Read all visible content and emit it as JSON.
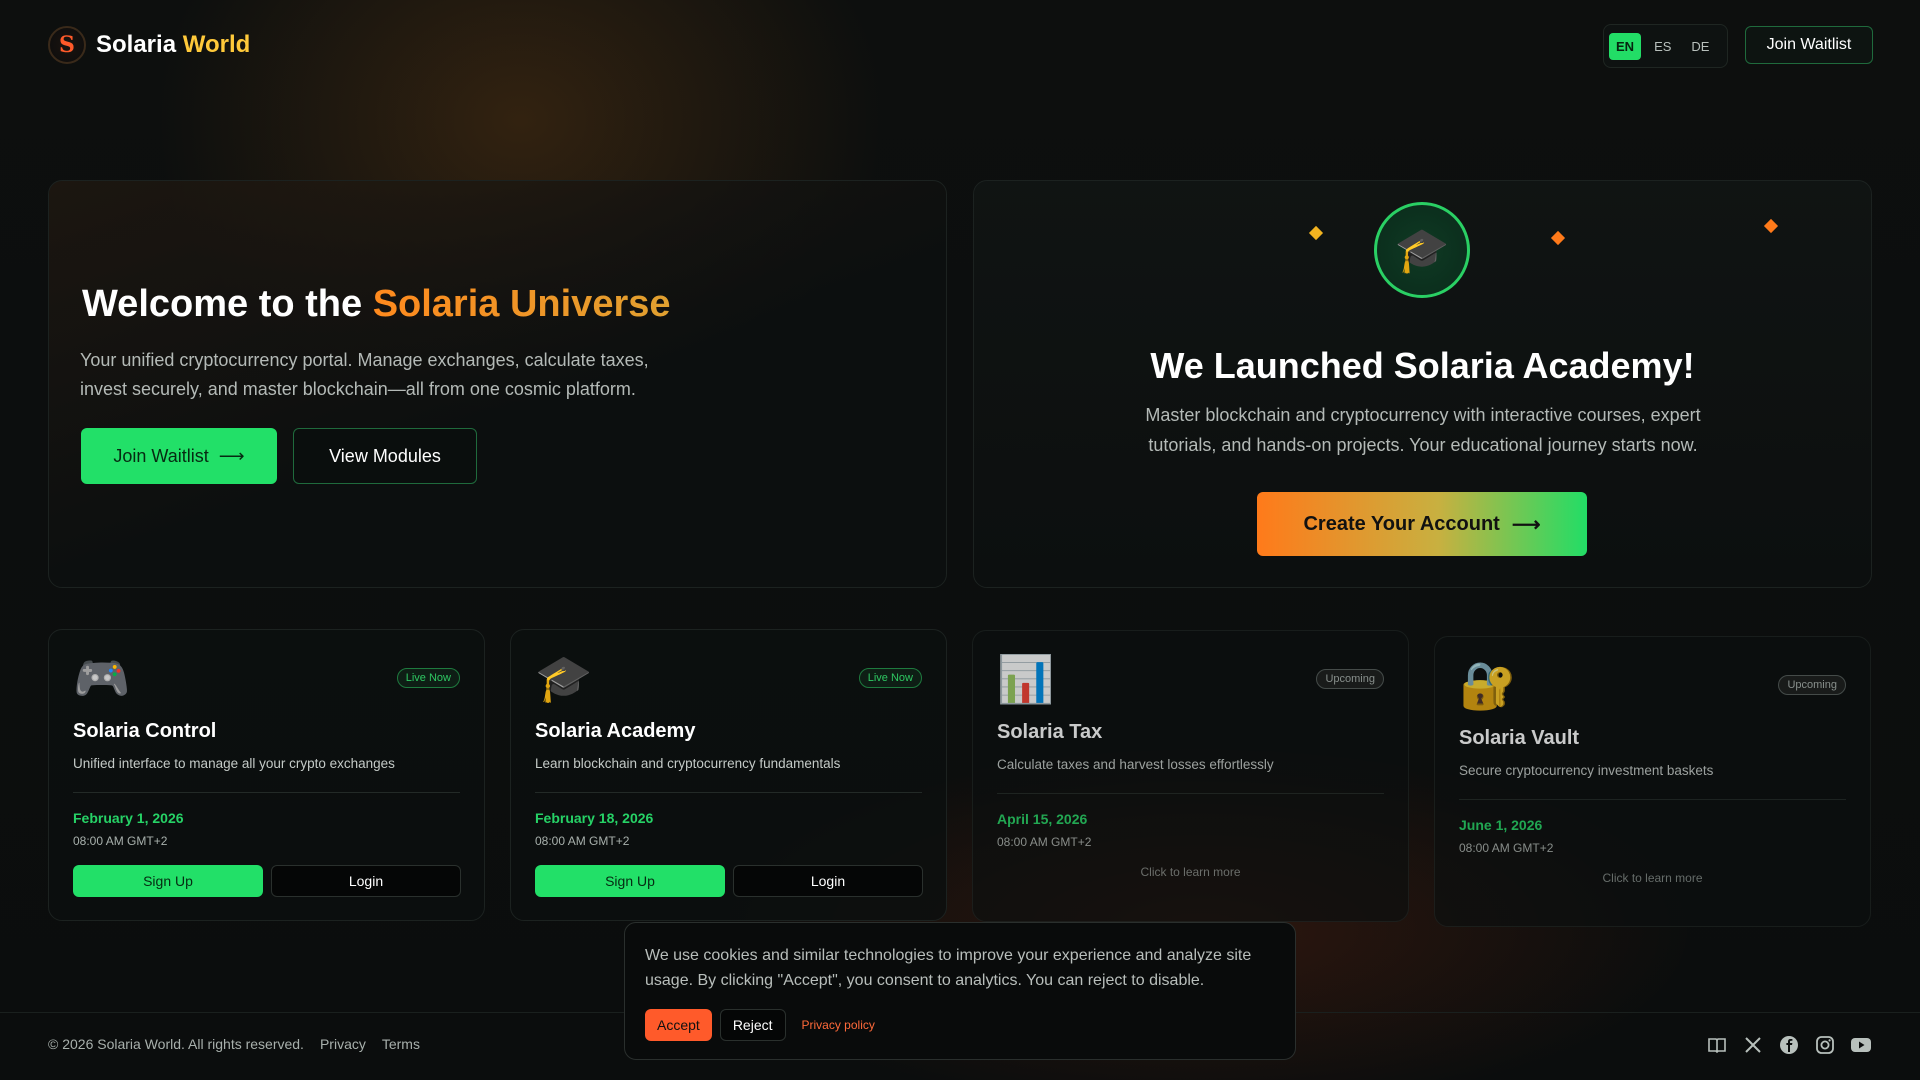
{
  "header": {
    "logo_letter": "S",
    "logo_name": "Solaria",
    "logo_accent": "World",
    "languages": [
      "EN",
      "ES",
      "DE"
    ],
    "active_language": "EN",
    "join_waitlist": "Join Waitlist"
  },
  "hero": {
    "title_prefix": "Welcome to the ",
    "title_highlight": "Solaria Universe",
    "description": "Your unified cryptocurrency portal. Manage exchanges, calculate taxes, invest securely, and master blockchain—all from one cosmic platform.",
    "primary_button": "Join Waitlist",
    "primary_arrow": "⟶",
    "secondary_button": "View Modules"
  },
  "announcement": {
    "icon": "graduation-cap-icon",
    "title": "We Launched Solaria Academy!",
    "description": "Master blockchain and cryptocurrency with interactive courses, expert tutorials, and hands-on projects. Your educational journey starts now.",
    "cta": "Create Your Account",
    "cta_arrow": "⟶"
  },
  "modules": [
    {
      "icon": "gamepad-icon",
      "glyph": "🎮",
      "badge": "Live Now",
      "status": "live",
      "title": "Solaria Control",
      "description": "Unified interface to manage all your crypto exchanges",
      "date": "February 1, 2026",
      "time": "08:00 AM GMT+2",
      "signup": "Sign Up",
      "login": "Login"
    },
    {
      "icon": "graduation-cap-icon",
      "glyph": "🎓",
      "badge": "Live Now",
      "status": "live",
      "title": "Solaria Academy",
      "description": "Learn blockchain and cryptocurrency fundamentals",
      "date": "February 18, 2026",
      "time": "08:00 AM GMT+2",
      "signup": "Sign Up",
      "login": "Login"
    },
    {
      "icon": "bar-chart-icon",
      "glyph": "📊",
      "badge": "Upcoming",
      "status": "upcoming",
      "title": "Solaria Tax",
      "description": "Calculate taxes and harvest losses effortlessly",
      "date": "April 15, 2026",
      "time": "08:00 AM GMT+2",
      "learn_more": "Click to learn more"
    },
    {
      "icon": "lock-icon",
      "glyph": "🔐",
      "badge": "Upcoming",
      "status": "upcoming",
      "title": "Solaria Vault",
      "description": "Secure cryptocurrency investment baskets",
      "date": "June 1, 2026",
      "time": "08:00 AM GMT+2",
      "learn_more": "Click to learn more"
    }
  ],
  "cookie": {
    "text": "We use cookies and similar technologies to improve your experience and analyze site usage. By clicking \"Accept\", you consent to analytics. You can reject to disable.",
    "accept": "Accept",
    "reject": "Reject",
    "policy": "Privacy policy"
  },
  "footer": {
    "copyright": "© 2026 Solaria World. All rights reserved.",
    "privacy": "Privacy",
    "terms": "Terms",
    "socials": [
      "book-icon",
      "x-icon",
      "facebook-icon",
      "instagram-icon",
      "youtube-icon"
    ]
  },
  "colors": {
    "brand_green": "#22e068",
    "brand_orange": "#ff7a1a",
    "accent_yellow": "#ffc93a",
    "background": "#0b0d0d"
  }
}
